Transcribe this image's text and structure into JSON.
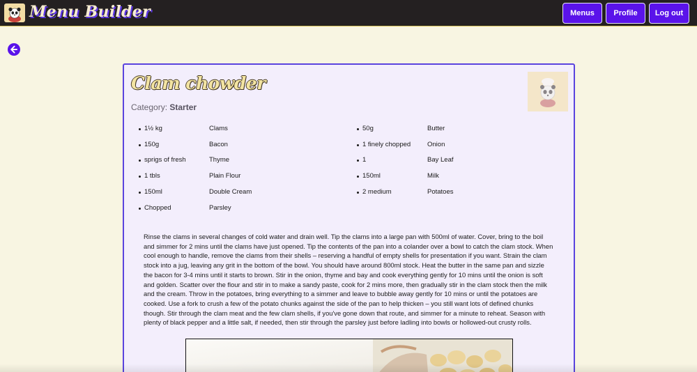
{
  "header": {
    "brand": "Menu Builder",
    "nav": [
      {
        "label": "Menus"
      },
      {
        "label": "Profile"
      },
      {
        "label": "Log out"
      }
    ]
  },
  "back": {
    "icon": "arrow-left-circle-icon"
  },
  "recipe": {
    "title": "Clam chowder",
    "category_label": "Category:",
    "category_value": "Starter",
    "ingredients_left": [
      {
        "qty": "1½ kg",
        "name": "Clams"
      },
      {
        "qty": "150g",
        "name": "Bacon"
      },
      {
        "qty": "sprigs of fresh",
        "name": "Thyme"
      },
      {
        "qty": "1 tbls",
        "name": "Plain Flour"
      },
      {
        "qty": "150ml",
        "name": "Double Cream"
      },
      {
        "qty": "Chopped",
        "name": "Parsley"
      }
    ],
    "ingredients_right": [
      {
        "qty": "50g",
        "name": "Butter"
      },
      {
        "qty": "1 finely chopped",
        "name": "Onion"
      },
      {
        "qty": "1",
        "name": "Bay Leaf"
      },
      {
        "qty": "150ml",
        "name": "Milk"
      },
      {
        "qty": "2 medium",
        "name": "Potatoes"
      }
    ],
    "method": "Rinse the clams in several changes of cold water and drain well. Tip the clams into a large pan with 500ml of water. Cover, bring to the boil and simmer for 2 mins until the clams have just opened. Tip the contents of the pan into a colander over a bowl to catch the clam stock. When cool enough to handle, remove the clams from their shells – reserving a handful of empty shells for presentation if you want. Strain the clam stock into a jug, leaving any grit in the bottom of the bowl. You should have around 800ml stock. Heat the butter in the same pan and sizzle the bacon for 3-4 mins until it starts to brown. Stir in the onion, thyme and bay and cook everything gently for 10 mins until the onion is soft and golden. Scatter over the flour and stir in to make a sandy paste, cook for 2 mins more, then gradually stir in the clam stock then the milk and the cream. Throw in the potatoes, bring everything to a simmer and leave to bubble away gently for 10 mins or until the potatoes are cooked. Use a fork to crush a few of the potato chunks against the side of the pan to help thicken – you still want lots of defined chunks though. Stir through the clam meat and the few clam shells, if you've gone down that route, and simmer for a minute to reheat. Season with plenty of black pepper and a little salt, if needed, then stir through the parsley just before ladling into bowls or hollowed-out crusty rolls."
  },
  "colors": {
    "page_bg": "#f8f5e2",
    "topbar_bg": "#242021",
    "accent": "#5a13ea",
    "card_border": "#5a43de",
    "card_bg": "#f3eefc"
  }
}
